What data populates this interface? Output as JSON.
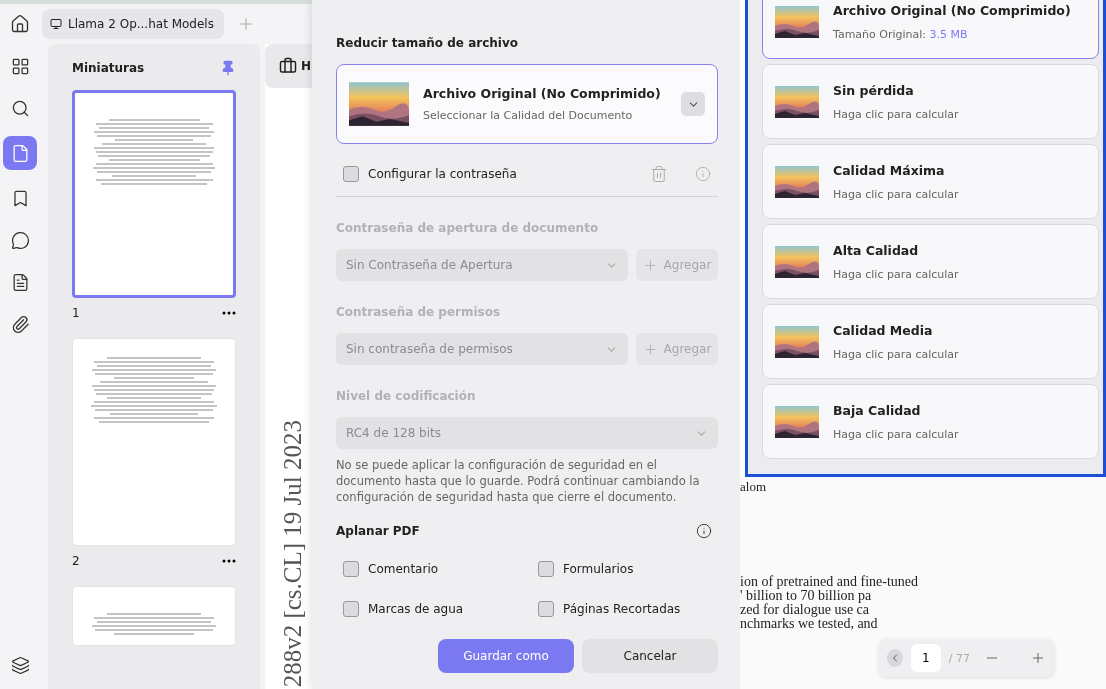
{
  "tab_bar": {
    "tabs": [
      {
        "label": "Llama 2 Op...hat Models",
        "selected": true
      }
    ]
  },
  "rail": {
    "items": [
      {
        "kind": "apps",
        "selected": false
      },
      {
        "kind": "search",
        "selected": false
      },
      {
        "kind": "pages",
        "selected": true
      },
      {
        "kind": "bookmarks",
        "selected": false
      },
      {
        "kind": "comments",
        "selected": false
      },
      {
        "kind": "forms",
        "selected": false
      },
      {
        "kind": "attachments",
        "selected": false
      },
      {
        "kind": "layers",
        "selected": false
      }
    ]
  },
  "thumbnails": {
    "title": "Miniaturas",
    "pages": [
      {
        "number": "1",
        "selected": true
      },
      {
        "number": "2",
        "selected": false
      },
      {
        "selected": false
      }
    ]
  },
  "document": {
    "toolbar_label": "H",
    "side_text": "288v2 [cs.CL] 19 Jul 2023",
    "fragment": "alom",
    "lines": [
      "ion of pretrained and fine-tuned",
      "' billion to 70 billion pa",
      "zed for dialogue use ca",
      "nchmarks we tested, and"
    ],
    "page_nav": {
      "page": "1",
      "total": "/ 77"
    }
  },
  "dialog": {
    "title": "Reducir tamaño de archivo",
    "quality": {
      "title": "Archivo Original (No Comprimido)",
      "subtitle": "Seleccionar la Calidad del Documento",
      "expanded": true
    },
    "password_toggle": {
      "label": "Configurar la contraseña",
      "checked": false
    },
    "fields": [
      {
        "label": "Contraseña de apertura de documento",
        "value": "Sin Contraseña de Apertura",
        "button": "Agregar",
        "disabled": true
      },
      {
        "label": "Contraseña de permisos",
        "value": "Sin contraseña de permisos",
        "button": "Agregar",
        "disabled": true
      },
      {
        "label": "Nivel de codificación",
        "value": "RC4 de 128 bits",
        "disabled": true
      }
    ],
    "note": "No se puede aplicar la configuración de seguridad en el documento hasta que lo guarde. Podrá continuar cambiando la configuración de seguridad hasta que cierre el documento.",
    "flatten": {
      "title": "Aplanar PDF",
      "options": [
        {
          "label": "Comentario",
          "checked": false
        },
        {
          "label": "Formularios",
          "checked": false
        },
        {
          "label": "Marcas de agua",
          "checked": false
        },
        {
          "label": "Páginas Recortadas",
          "checked": false
        }
      ]
    },
    "buttons": [
      {
        "label": "Guardar como",
        "kind": "primary"
      },
      {
        "label": "Cancelar",
        "kind": "secondary"
      }
    ]
  },
  "quality_list": {
    "options": [
      {
        "title": "Archivo Original (No Comprimido)",
        "subtitle": "Tamaño Original:",
        "value": "3.5 MB",
        "selected": true
      },
      {
        "title": "Sin pérdida",
        "subtitle": "Haga clic para calcular",
        "selected": false
      },
      {
        "title": "Calidad Máxima",
        "subtitle": "Haga clic para calcular",
        "selected": false
      },
      {
        "title": "Alta Calidad",
        "subtitle": "Haga clic para calcular",
        "selected": false
      },
      {
        "title": "Calidad Media",
        "subtitle": "Haga clic para calcular",
        "selected": false
      },
      {
        "title": "Baja Calidad",
        "subtitle": "Haga clic para calcular",
        "selected": false
      }
    ]
  }
}
